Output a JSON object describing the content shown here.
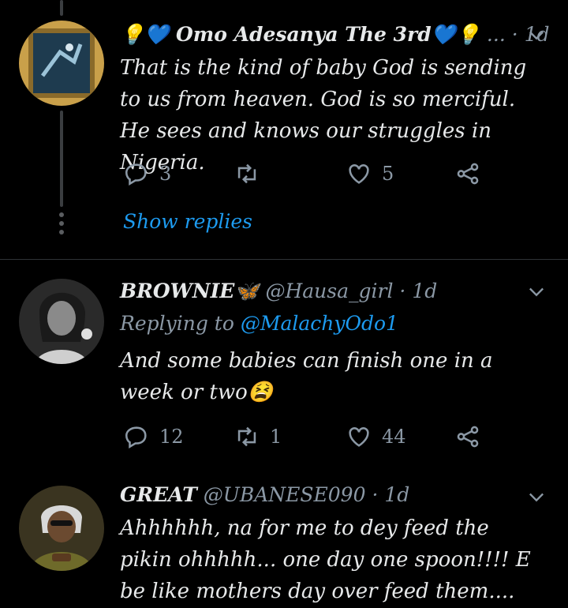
{
  "tweets": [
    {
      "name_prefix": "💡💙",
      "name": "Omo Adesanya The 3rd",
      "name_suffix": "💙💡",
      "handle": "...",
      "time": "1d",
      "text": "That is the kind of baby God is sending to us from heaven. God is so merciful. He sees and knows our struggles in Nigeria.",
      "replies": "3",
      "retweets": "",
      "likes": "5",
      "show_replies": "Show replies"
    },
    {
      "name": "BROWNIE",
      "name_suffix": "🦋",
      "handle": "@Hausa_girl",
      "time": "1d",
      "replying_label": "Replying to",
      "replying_to": "@MalachyOdo1",
      "text": "And some babies can finish one in a week or two😫",
      "replies": "12",
      "retweets": "1",
      "likes": "44"
    },
    {
      "name": "GREAT",
      "handle": "@UBANESE090",
      "time": "1d",
      "text": "Ahhhhhh, na for me to dey feed the pikin ohhhhh... one day one spoon!!!! E be like mothers day over feed them...."
    }
  ],
  "colors": {
    "background": "#000000",
    "accent": "#1d9bf0",
    "muted": "#8b98a5",
    "divider": "#2f3336"
  },
  "icons": [
    "reply-icon",
    "retweet-icon",
    "like-icon",
    "share-icon",
    "chevron-down-icon"
  ]
}
